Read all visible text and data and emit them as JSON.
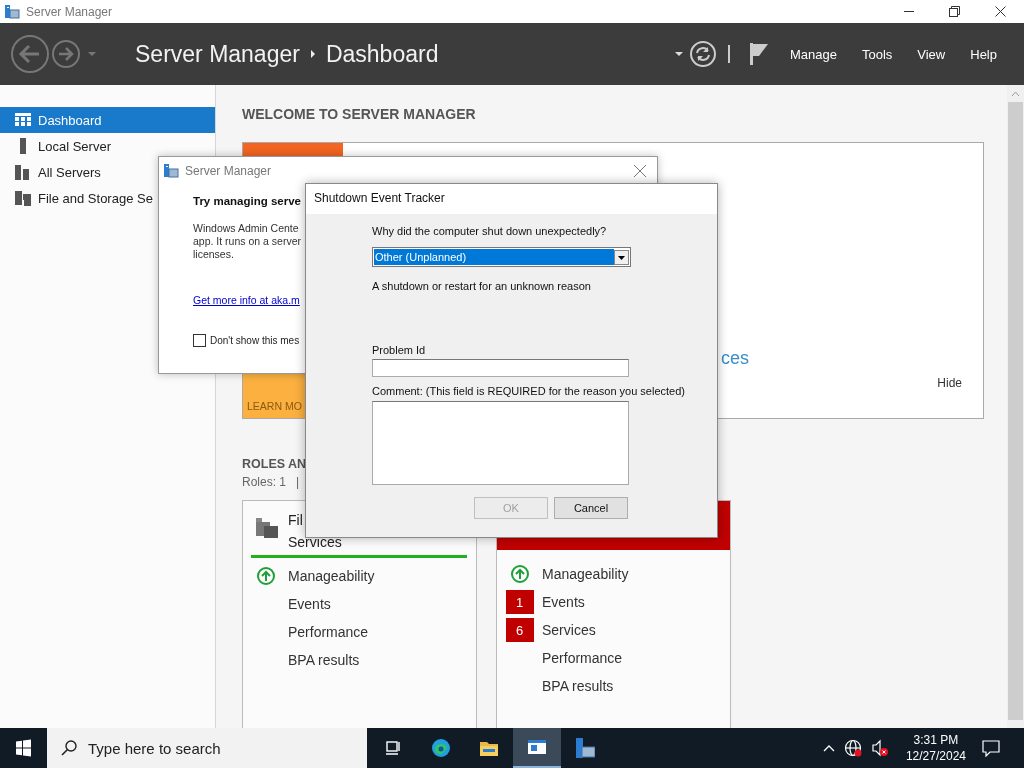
{
  "window": {
    "title": "Server Manager"
  },
  "header": {
    "breadcrumb": [
      "Server Manager",
      "Dashboard"
    ],
    "menu": [
      "Manage",
      "Tools",
      "View",
      "Help"
    ]
  },
  "sidebar": {
    "items": [
      {
        "label": "Dashboard",
        "kind": "dashboard",
        "selected": true
      },
      {
        "label": "Local Server",
        "kind": "server",
        "selected": false
      },
      {
        "label": "All Servers",
        "kind": "servers",
        "selected": false
      },
      {
        "label": "File and Storage Se",
        "kind": "storage",
        "selected": false
      }
    ]
  },
  "welcome": {
    "heading": "WELCOME TO SERVER MANAGER",
    "tile_label": "LEARN MO",
    "link_fragment": "ces",
    "hide": "Hide"
  },
  "roles": {
    "heading": "ROLES AN",
    "summary": "Roles: 1",
    "separator": "|"
  },
  "tiles": [
    {
      "kind": "ok",
      "title_lines": [
        "Fil",
        "Services"
      ],
      "rows": [
        {
          "label": "Manageability",
          "kind": "ok"
        },
        {
          "label": "Events",
          "kind": "plain"
        },
        {
          "label": "Performance",
          "kind": "plain"
        },
        {
          "label": "BPA results",
          "kind": "plain"
        }
      ]
    },
    {
      "kind": "alert",
      "rows": [
        {
          "label": "Manageability",
          "kind": "ok"
        },
        {
          "label": "Events",
          "kind": "count",
          "count": "1"
        },
        {
          "label": "Services",
          "kind": "count",
          "count": "6"
        },
        {
          "label": "Performance",
          "kind": "plain"
        },
        {
          "label": "BPA results",
          "kind": "plain"
        }
      ]
    }
  ],
  "message_dialog": {
    "title": "Server Manager",
    "heading": "Try managing serve",
    "body": "Windows Admin Cente\napp. It runs on a server\nlicenses.",
    "link": "Get more info at aka.m",
    "checkbox": {
      "label": "Don't show this mes",
      "checked": false
    }
  },
  "shutdown_dialog": {
    "title": "Shutdown Event Tracker",
    "question": "Why did the computer shut down unexpectedly?",
    "reason": "Other (Unplanned)",
    "description": "A shutdown or restart for an unknown reason",
    "problem_id_label": "Problem Id",
    "comment_label": "Comment: (This field is REQUIRED for the reason you selected)",
    "buttons": [
      {
        "label": "OK",
        "disabled": true
      },
      {
        "label": "Cancel",
        "disabled": false
      }
    ]
  },
  "taskbar": {
    "search_placeholder": "Type here to search",
    "apps": [
      {
        "kind": "task-view",
        "selected": false
      },
      {
        "kind": "browser",
        "selected": false
      },
      {
        "kind": "folder",
        "selected": false
      },
      {
        "kind": "window",
        "selected": true
      },
      {
        "kind": "server-manager",
        "selected": false
      }
    ],
    "time": "3:31 PM",
    "date": "12/27/2024"
  }
}
